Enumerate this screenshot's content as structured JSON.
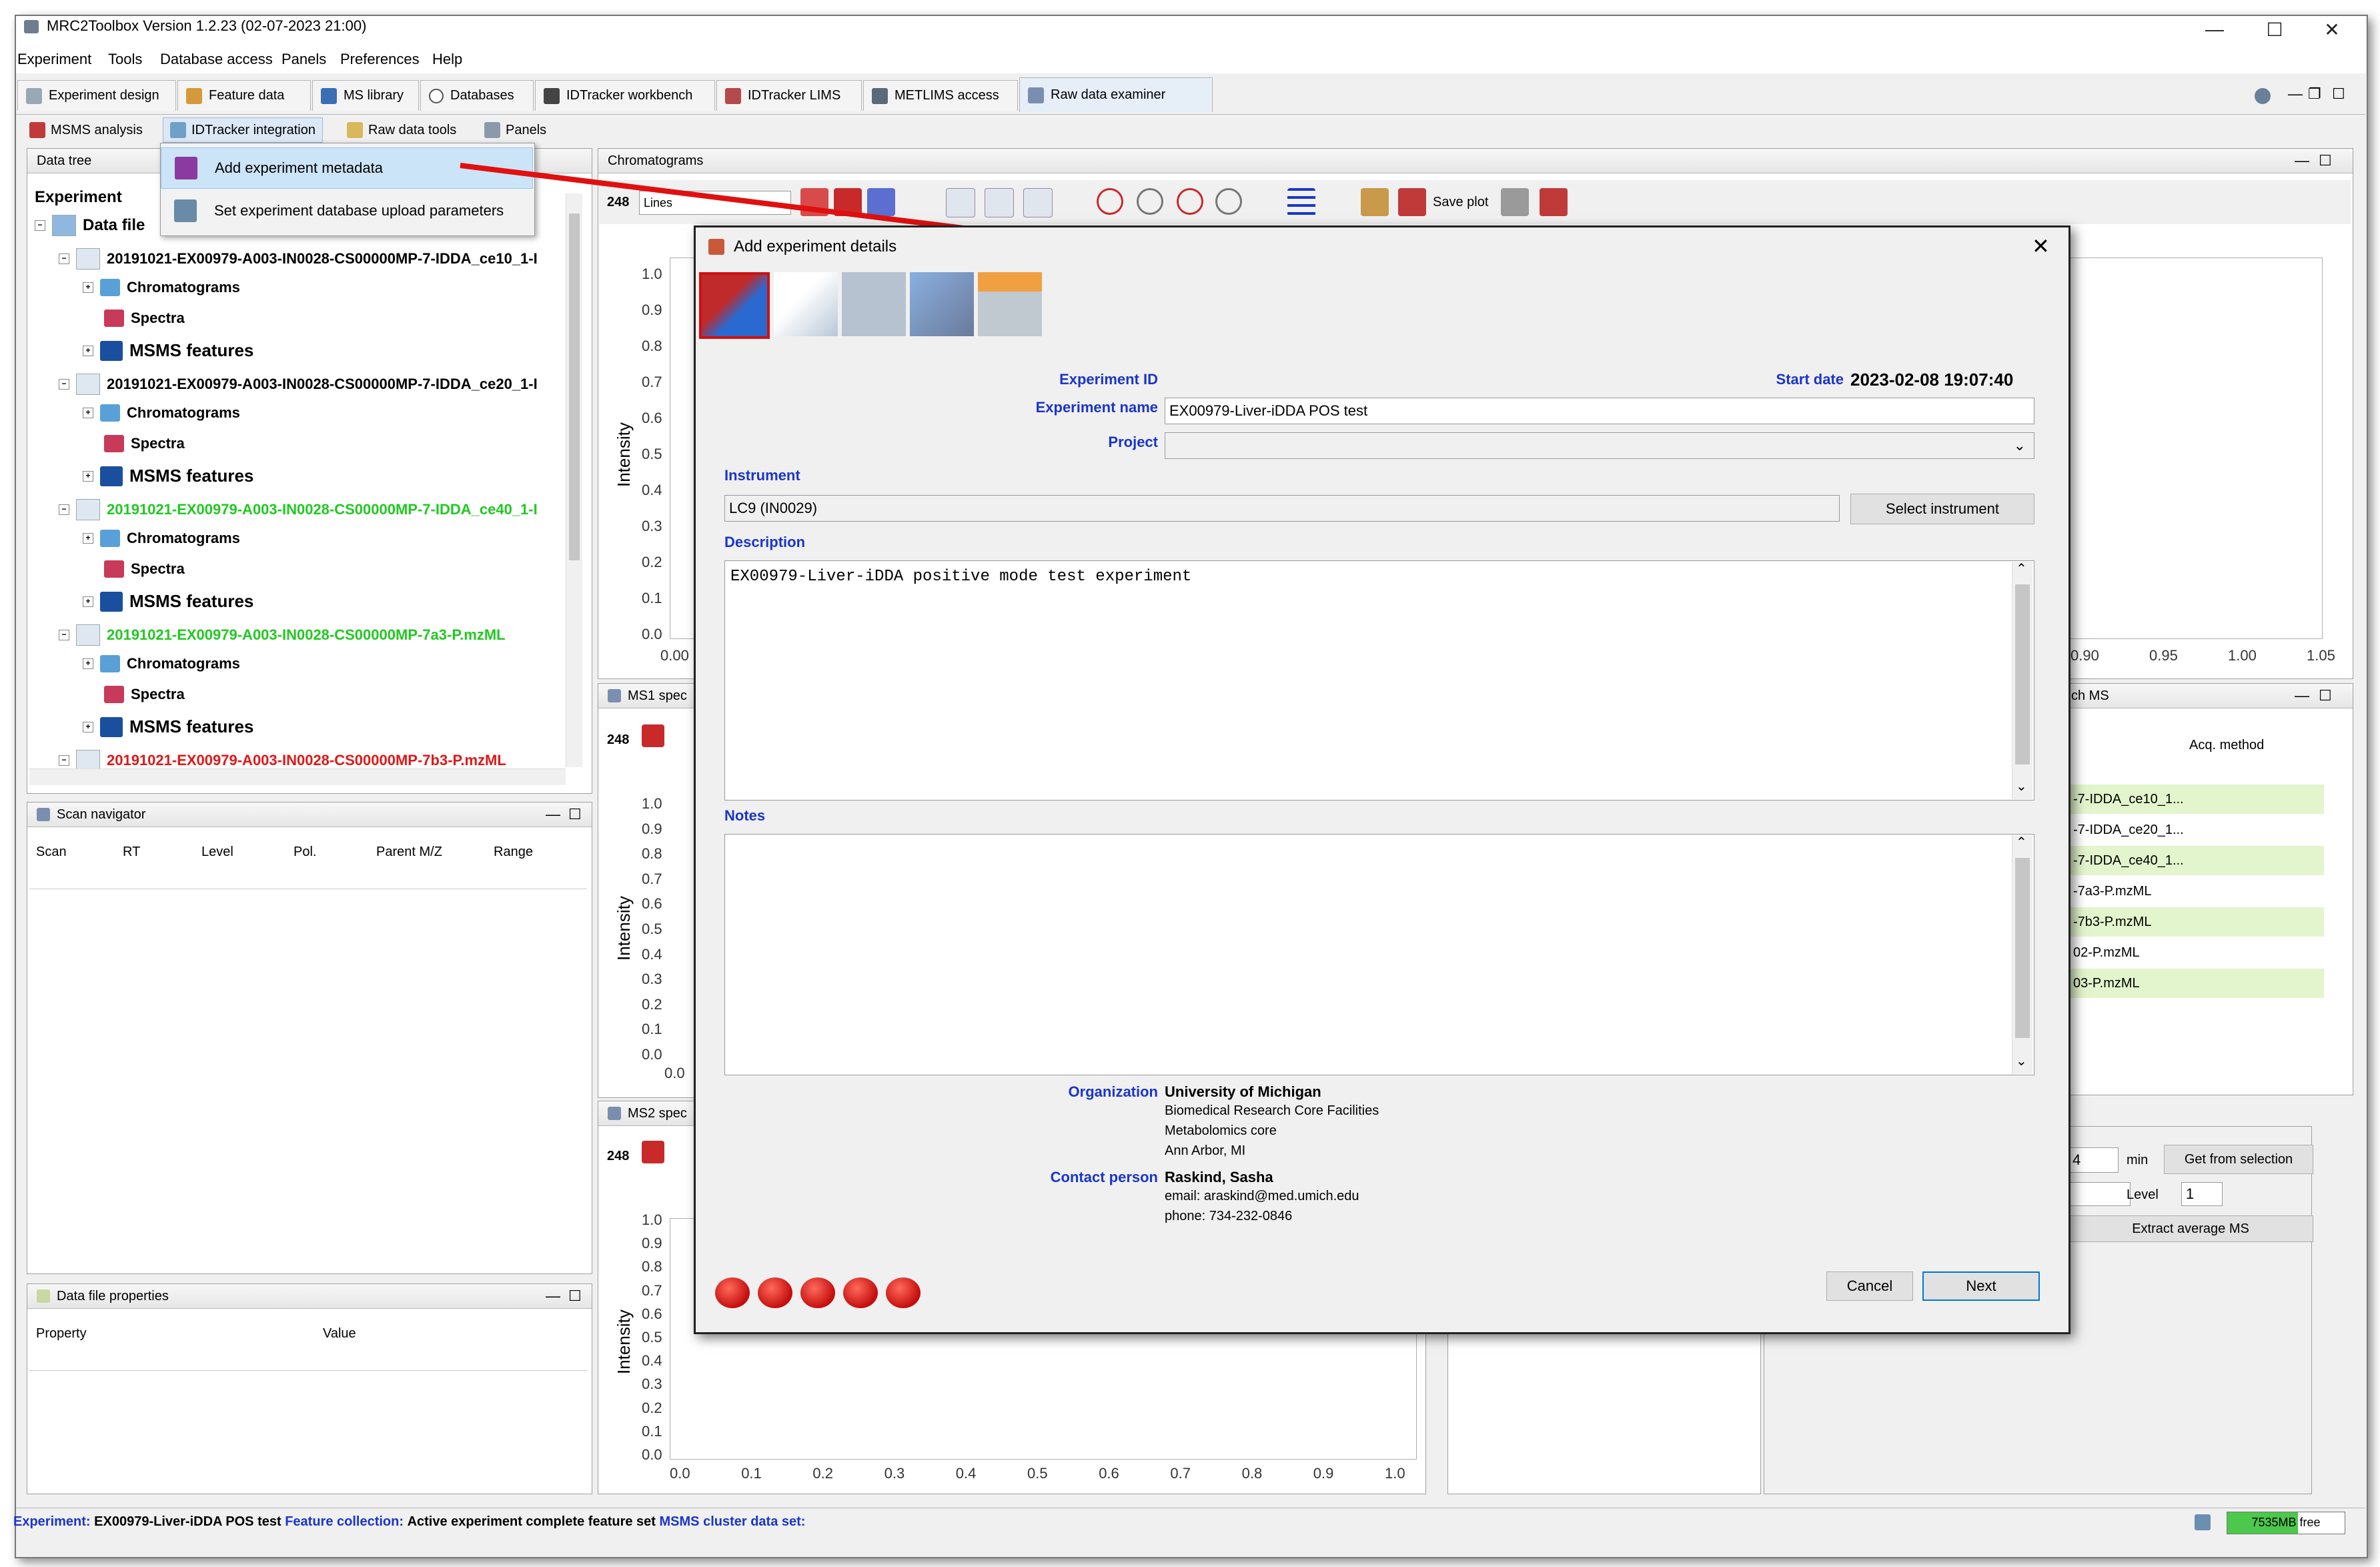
{
  "window": {
    "title": "MRC2Toolbox Version 1.2.23 (02-07-2023 21:00)",
    "minimize": "—",
    "maximize": "☐",
    "close": "✕"
  },
  "menu": [
    "Experiment",
    "Tools",
    "Database access",
    "Panels",
    "Preferences",
    "Help"
  ],
  "main_tabs": [
    "Experiment design",
    "Feature data",
    "MS library",
    "Databases",
    "IDTracker workbench",
    "IDTracker LIMS",
    "METLIMS access",
    "Raw data examiner"
  ],
  "sub_tabs": [
    "MSMS analysis",
    "IDTracker integration",
    "Raw data tools",
    "Panels"
  ],
  "popup_menu": [
    "Add experiment metadata",
    "Set experiment database upload parameters"
  ],
  "data_tree": {
    "panel_title": "Data tree",
    "root": "Experiment",
    "data_files": "Data file",
    "files": [
      {
        "name": "20191021-EX00979-A003-IN0028-CS00000MP-7-IDDA_ce10_1-I",
        "color": "#000000"
      },
      {
        "name": "20191021-EX00979-A003-IN0028-CS00000MP-7-IDDA_ce20_1-I",
        "color": "#000000"
      },
      {
        "name": "20191021-EX00979-A003-IN0028-CS00000MP-7-IDDA_ce40_1-I",
        "color": "#22c822"
      },
      {
        "name": "20191021-EX00979-A003-IN0028-CS00000MP-7a3-P.mzML",
        "color": "#22c822"
      },
      {
        "name": "20191021-EX00979-A003-IN0028-CS00000MP-7b3-P.mzML",
        "color": "#e01818"
      }
    ],
    "children": [
      "Chromatograms",
      "Spectra",
      "MSMS features"
    ]
  },
  "scan_navigator": {
    "title": "Scan navigator",
    "columns": [
      "Scan",
      "RT",
      "Level",
      "Pol.",
      "Parent M/Z",
      "Range"
    ]
  },
  "data_file_properties": {
    "title": "Data file properties",
    "columns": [
      "Property",
      "Value"
    ]
  },
  "chromatograms": {
    "title": "Chromatograms",
    "mode": "Lines",
    "save_plot": "Save plot",
    "badge": "248",
    "y_label": "Intensity",
    "y_ticks": [
      "1.0",
      "0.9",
      "0.8",
      "0.7",
      "0.6",
      "0.5",
      "0.4",
      "0.3",
      "0.2",
      "0.1",
      "0.0"
    ],
    "x_tick_first": "0.00",
    "x_ticks_right": [
      "0.90",
      "0.95",
      "1.00",
      "1.05"
    ]
  },
  "ms1": {
    "title": "MS1 spec",
    "badge": "248",
    "y_label": "Intensity",
    "y_ticks": [
      "1.0",
      "0.9",
      "0.8",
      "0.7",
      "0.6",
      "0.5",
      "0.4",
      "0.3",
      "0.2",
      "0.1",
      "0.0"
    ],
    "x_tick_first": "0.0"
  },
  "ms2": {
    "title": "MS2 spec",
    "badge": "248",
    "y_label": "Intensity",
    "y_ticks": [
      "1.0",
      "0.9",
      "0.8",
      "0.7",
      "0.6",
      "0.5",
      "0.4",
      "0.3",
      "0.2",
      "0.1",
      "0.0"
    ],
    "x_ticks": [
      "0.0",
      "0.1",
      "0.2",
      "0.3",
      "0.4",
      "0.5",
      "0.6",
      "0.7",
      "0.8",
      "0.9",
      "1.0"
    ]
  },
  "right_panel": {
    "title": "ch MS",
    "column": "Acq. method",
    "rows": [
      "-7-IDDA_ce10_1...",
      "-7-IDDA_ce20_1...",
      "-7-IDDA_ce40_1...",
      "-7a3-P.mzML",
      "-7b3-P.mzML",
      "02-P.mzML",
      "03-P.mzML"
    ],
    "rt_value": "4",
    "rt_unit": "min",
    "get_from_selection": "Get from selection",
    "level_label": "Level",
    "level_value": "1",
    "extract_average": "Extract average MS"
  },
  "dialog": {
    "title": "Add experiment details",
    "experiment_id_label": "Experiment ID",
    "start_date_label": "Start date",
    "start_date": "2023-02-08 19:07:40",
    "experiment_name_label": "Experiment name",
    "experiment_name": "EX00979-Liver-iDDA POS test",
    "project_label": "Project",
    "instrument_label": "Instrument",
    "instrument": "LC9 (IN0029)",
    "select_instrument": "Select instrument",
    "description_label": "Description",
    "description": "EX00979-Liver-iDDA positive mode test experiment",
    "notes_label": "Notes",
    "organization_label": "Organization",
    "organization": "University of Michigan",
    "org_lines": [
      "Biomedical Research Core Facilities",
      "Metabolomics core",
      "Ann Arbor, MI"
    ],
    "contact_label": "Contact person",
    "contact": "Raskind, Sasha",
    "contact_lines": [
      "email: araskind@med.umich.edu",
      "phone: 734-232-0846"
    ],
    "cancel": "Cancel",
    "next": "Next",
    "step_count": 5
  },
  "status_bar": {
    "experiment_label": "Experiment:",
    "experiment": "EX00979-Liver-iDDA POS test",
    "feature_label": "Feature collection:",
    "feature": "Active experiment complete feature set",
    "msms_label": "MSMS cluster data set:",
    "memory": "7535MB free",
    "memory_used_fraction": 0.6
  },
  "colors": {
    "label_blue": "#1a35c9",
    "arrow_red": "#e01010",
    "green_file": "#22c822",
    "red_file": "#e01818"
  }
}
